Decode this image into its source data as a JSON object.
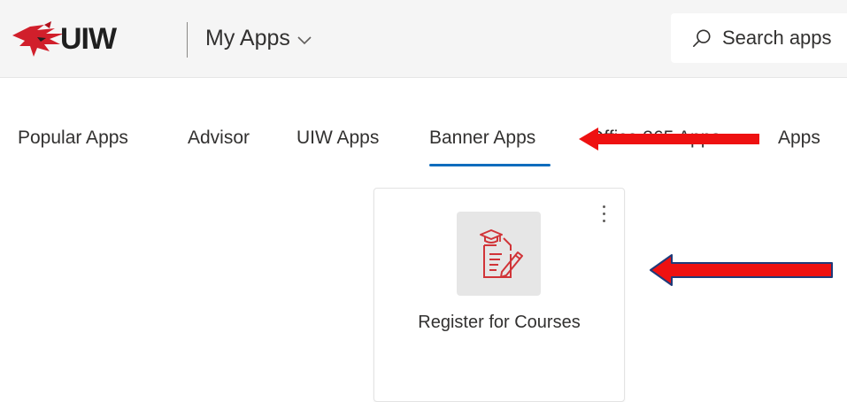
{
  "header": {
    "logo_text": "UIW",
    "app_title": "My Apps",
    "search": {
      "placeholder": "Search apps"
    }
  },
  "tabs": [
    {
      "label": "Popular Apps",
      "active": false
    },
    {
      "label": "Advisor",
      "active": false
    },
    {
      "label": "UIW Apps",
      "active": false
    },
    {
      "label": "Banner Apps",
      "active": true
    },
    {
      "label": "Office 365 Apps",
      "active": false
    },
    {
      "label": "Apps",
      "active": false
    }
  ],
  "cards": [
    {
      "label": "Register for Courses",
      "icon": "register-document-icon"
    }
  ],
  "colors": {
    "header_bg": "#f5f5f5",
    "accent": "#0f6cbd",
    "logo_red": "#d11f2b",
    "icon_red": "#d13438",
    "annotation_red": "#ee1111",
    "annotation_outline": "#1f3b7a"
  },
  "icons": {
    "logo": "cardinal-logo-icon",
    "chevron": "chevron-down-icon",
    "search": "search-icon",
    "more": "more-vertical-icon"
  }
}
